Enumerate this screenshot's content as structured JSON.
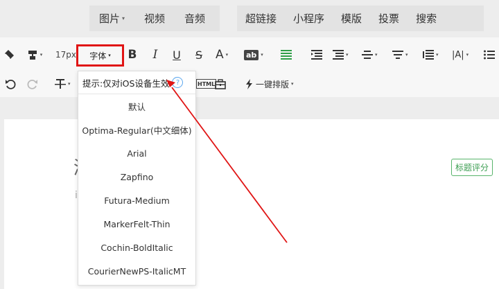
{
  "insert_bar": {
    "items": [
      {
        "label": "图片",
        "caret": "▾"
      },
      {
        "label": "视频"
      },
      {
        "label": "音频"
      },
      {
        "label": "超链接"
      },
      {
        "label": "小程序"
      },
      {
        "label": "模版"
      },
      {
        "label": "投票"
      },
      {
        "label": "搜索"
      }
    ]
  },
  "toolbar": {
    "font_size": "17px",
    "font_family": "字体",
    "bold": "B",
    "italic": "I",
    "underline": "U",
    "strike": "S",
    "font_color": "A",
    "bg_color": "ab",
    "align_glyph": "|A|",
    "one_click_layout": "一键排版",
    "html_label": "HTML"
  },
  "font_dropdown": {
    "hint": "提示:仅对iOS设备生效",
    "help": "?",
    "options": [
      "默认",
      "Optima-Regular(中文细体)",
      "Arial",
      "Zapfino",
      "Futura-Medium",
      "MarkerFelt-Thin",
      "Cochin-BoldItalic",
      "CourierNewPS-ItalicMT"
    ]
  },
  "editor": {
    "title_char": "渐",
    "subtitle_char": "i",
    "score_button": "标题评分"
  },
  "colors": {
    "accent_green": "#2e9e47",
    "highlight_red": "#e01515",
    "help_blue": "#5aa6ee"
  }
}
